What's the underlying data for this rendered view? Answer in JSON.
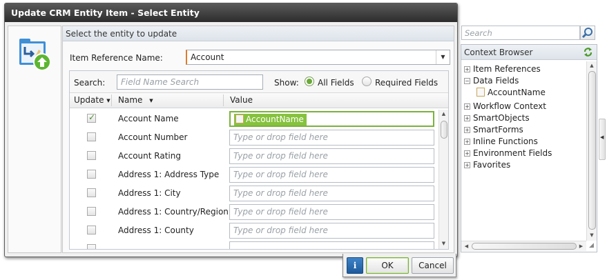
{
  "dialog": {
    "title": "Update CRM Entity Item - Select Entity",
    "panel_title": "Select the entity to update",
    "item_reference": {
      "label": "Item Reference Name:",
      "value": "Account"
    },
    "search": {
      "label": "Search:",
      "placeholder": "Field Name Search"
    },
    "show": {
      "label": "Show:",
      "options": [
        "All Fields",
        "Required Fields"
      ],
      "selected": "All Fields"
    },
    "columns": {
      "update": "Update",
      "name": "Name",
      "value": "Value"
    },
    "rows": [
      {
        "name": "Account Name",
        "checked": true,
        "value_token": "AccountName"
      },
      {
        "name": "Account Number",
        "checked": false,
        "placeholder": "Type or drop field here"
      },
      {
        "name": "Account Rating",
        "checked": false,
        "placeholder": "Type or drop field here"
      },
      {
        "name": "Address 1: Address Type",
        "checked": false,
        "placeholder": "Type or drop field here"
      },
      {
        "name": "Address 1: City",
        "checked": false,
        "placeholder": "Type or drop field here"
      },
      {
        "name": "Address 1: Country/Region",
        "checked": false,
        "placeholder": "Type or drop field here"
      },
      {
        "name": "Address 1: County",
        "checked": false,
        "placeholder": "Type or drop field here"
      }
    ],
    "buttons": {
      "info": "i",
      "ok": "OK",
      "cancel": "Cancel"
    }
  },
  "context_browser": {
    "search_placeholder": "Search",
    "title": "Context Browser",
    "nodes": {
      "item_references": "Item References",
      "data_fields": "Data Fields",
      "account_name": "AccountName",
      "workflow_context": "Workflow Context",
      "smartobjects": "SmartObjects",
      "smartforms": "SmartForms",
      "inline_functions": "Inline Functions",
      "environment_fields": "Environment Fields",
      "favorites": "Favorites"
    }
  },
  "colors": {
    "accent_green": "#86c23e",
    "title_bar": "#3a3a3a",
    "info_blue": "#2a6db3"
  }
}
